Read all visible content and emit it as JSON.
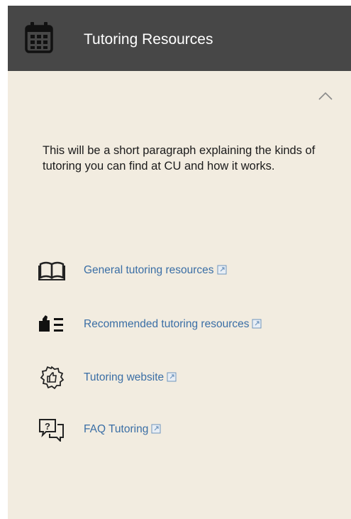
{
  "header": {
    "title": "Tutoring Resources",
    "icon": "calendar-icon",
    "bg_color": "#474747"
  },
  "collapse": {
    "icon": "chevron-up-icon"
  },
  "intro": {
    "text": "This will be a short paragraph explaining the kinds of tutoring you can find at CU and how it works."
  },
  "links": [
    {
      "label": "General tutoring resources",
      "icon": "open-book-icon"
    },
    {
      "label": "Recommended tutoring resources",
      "icon": "recommended-list-icon"
    },
    {
      "label": "Tutoring website",
      "icon": "thumbs-up-badge-icon"
    },
    {
      "label": "FAQ Tutoring",
      "icon": "question-chat-icon"
    }
  ],
  "colors": {
    "panel_bg": "#f2ece0",
    "link": "#3a6ea5",
    "text": "#1b1b1b"
  }
}
